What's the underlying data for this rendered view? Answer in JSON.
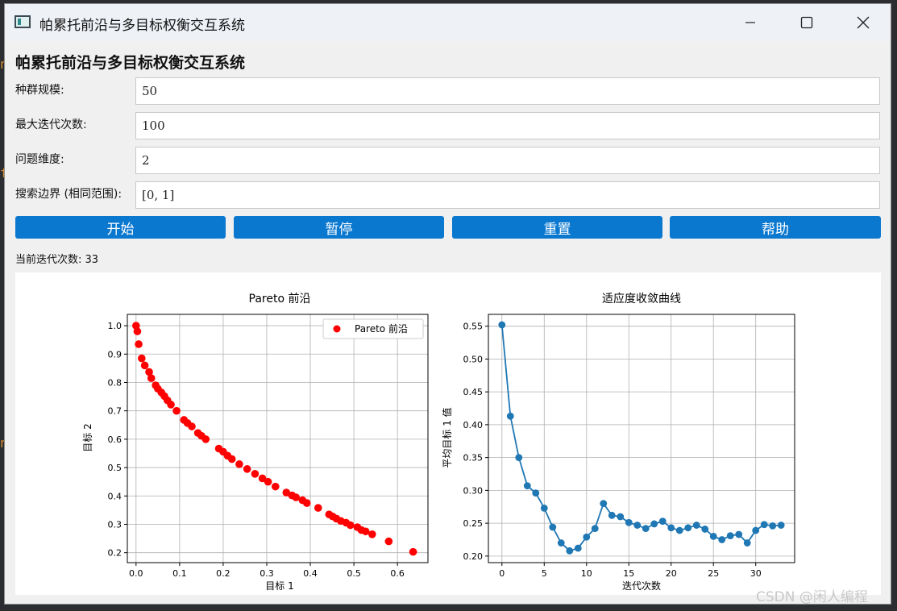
{
  "window": {
    "title": "帕累托前沿与多目标权衡交互系统"
  },
  "header": {
    "title": "帕累托前沿与多目标权衡交互系统"
  },
  "form": {
    "fields": [
      {
        "label": "种群规模:",
        "value": "50"
      },
      {
        "label": "最大迭代次数:",
        "value": "100"
      },
      {
        "label": "问题维度:",
        "value": "2"
      },
      {
        "label": "搜索边界 (相同范围):",
        "value": "[0, 1]"
      }
    ]
  },
  "buttons": {
    "start": "开始",
    "pause": "暂停",
    "reset": "重置",
    "help": "帮助"
  },
  "status": {
    "text": "当前迭代次数: 33"
  },
  "watermark": "CSDN @闲人编程",
  "colors": {
    "button_bg": "#0b78d0",
    "pareto_marker": "#ff0000",
    "convergence_line": "#1f77b4"
  },
  "chart_data": [
    {
      "type": "scatter",
      "title": "Pareto 前沿",
      "xlabel": "目标 1",
      "ylabel": "目标 2",
      "xlim": [
        -0.02,
        0.67
      ],
      "ylim": [
        0.165,
        1.04
      ],
      "xticks": [
        "0.0",
        "0.1",
        "0.2",
        "0.3",
        "0.4",
        "0.5",
        "0.6"
      ],
      "yticks": [
        "0.2",
        "0.3",
        "0.4",
        "0.5",
        "0.6",
        "0.7",
        "0.8",
        "0.9",
        "1.0"
      ],
      "grid": true,
      "legend": "top-right",
      "series": [
        {
          "name": "Pareto 前沿",
          "color": "#ff0000",
          "x": [
            0.0,
            0.003,
            0.006,
            0.013,
            0.02,
            0.03,
            0.035,
            0.045,
            0.05,
            0.058,
            0.065,
            0.072,
            0.08,
            0.093,
            0.11,
            0.118,
            0.128,
            0.142,
            0.15,
            0.16,
            0.19,
            0.2,
            0.21,
            0.22,
            0.237,
            0.255,
            0.273,
            0.29,
            0.303,
            0.32,
            0.345,
            0.358,
            0.367,
            0.382,
            0.392,
            0.418,
            0.443,
            0.451,
            0.46,
            0.47,
            0.482,
            0.492,
            0.508,
            0.517,
            0.527,
            0.542,
            0.58,
            0.636
          ],
          "y": [
            1.0,
            0.98,
            0.935,
            0.885,
            0.86,
            0.837,
            0.815,
            0.79,
            0.778,
            0.765,
            0.752,
            0.737,
            0.722,
            0.7,
            0.668,
            0.657,
            0.645,
            0.622,
            0.612,
            0.6,
            0.567,
            0.556,
            0.542,
            0.53,
            0.512,
            0.495,
            0.478,
            0.462,
            0.45,
            0.433,
            0.412,
            0.402,
            0.395,
            0.385,
            0.375,
            0.358,
            0.335,
            0.328,
            0.32,
            0.312,
            0.306,
            0.297,
            0.29,
            0.28,
            0.275,
            0.265,
            0.24,
            0.203
          ]
        }
      ]
    },
    {
      "type": "line",
      "title": "适应度收敛曲线",
      "xlabel": "迭代次数",
      "ylabel": "平均目标 1 值",
      "xlim": [
        -1.6,
        34.6
      ],
      "ylim": [
        0.19,
        0.568
      ],
      "xticks": [
        "0",
        "5",
        "10",
        "15",
        "20",
        "25",
        "30"
      ],
      "yticks": [
        "0.20",
        "0.25",
        "0.30",
        "0.35",
        "0.40",
        "0.45",
        "0.50",
        "0.55"
      ],
      "grid": true,
      "series": [
        {
          "color": "#1f77b4",
          "x": [
            0,
            1,
            2,
            3,
            4,
            5,
            6,
            7,
            8,
            9,
            10,
            11,
            12,
            13,
            14,
            15,
            16,
            17,
            18,
            19,
            20,
            21,
            22,
            23,
            24,
            25,
            26,
            27,
            28,
            29,
            30,
            31,
            32,
            33
          ],
          "y": [
            0.552,
            0.413,
            0.35,
            0.307,
            0.296,
            0.273,
            0.244,
            0.22,
            0.208,
            0.212,
            0.229,
            0.242,
            0.28,
            0.262,
            0.26,
            0.251,
            0.247,
            0.242,
            0.249,
            0.253,
            0.243,
            0.239,
            0.243,
            0.247,
            0.241,
            0.23,
            0.225,
            0.231,
            0.233,
            0.22,
            0.239,
            0.248,
            0.246,
            0.247
          ]
        }
      ]
    }
  ]
}
